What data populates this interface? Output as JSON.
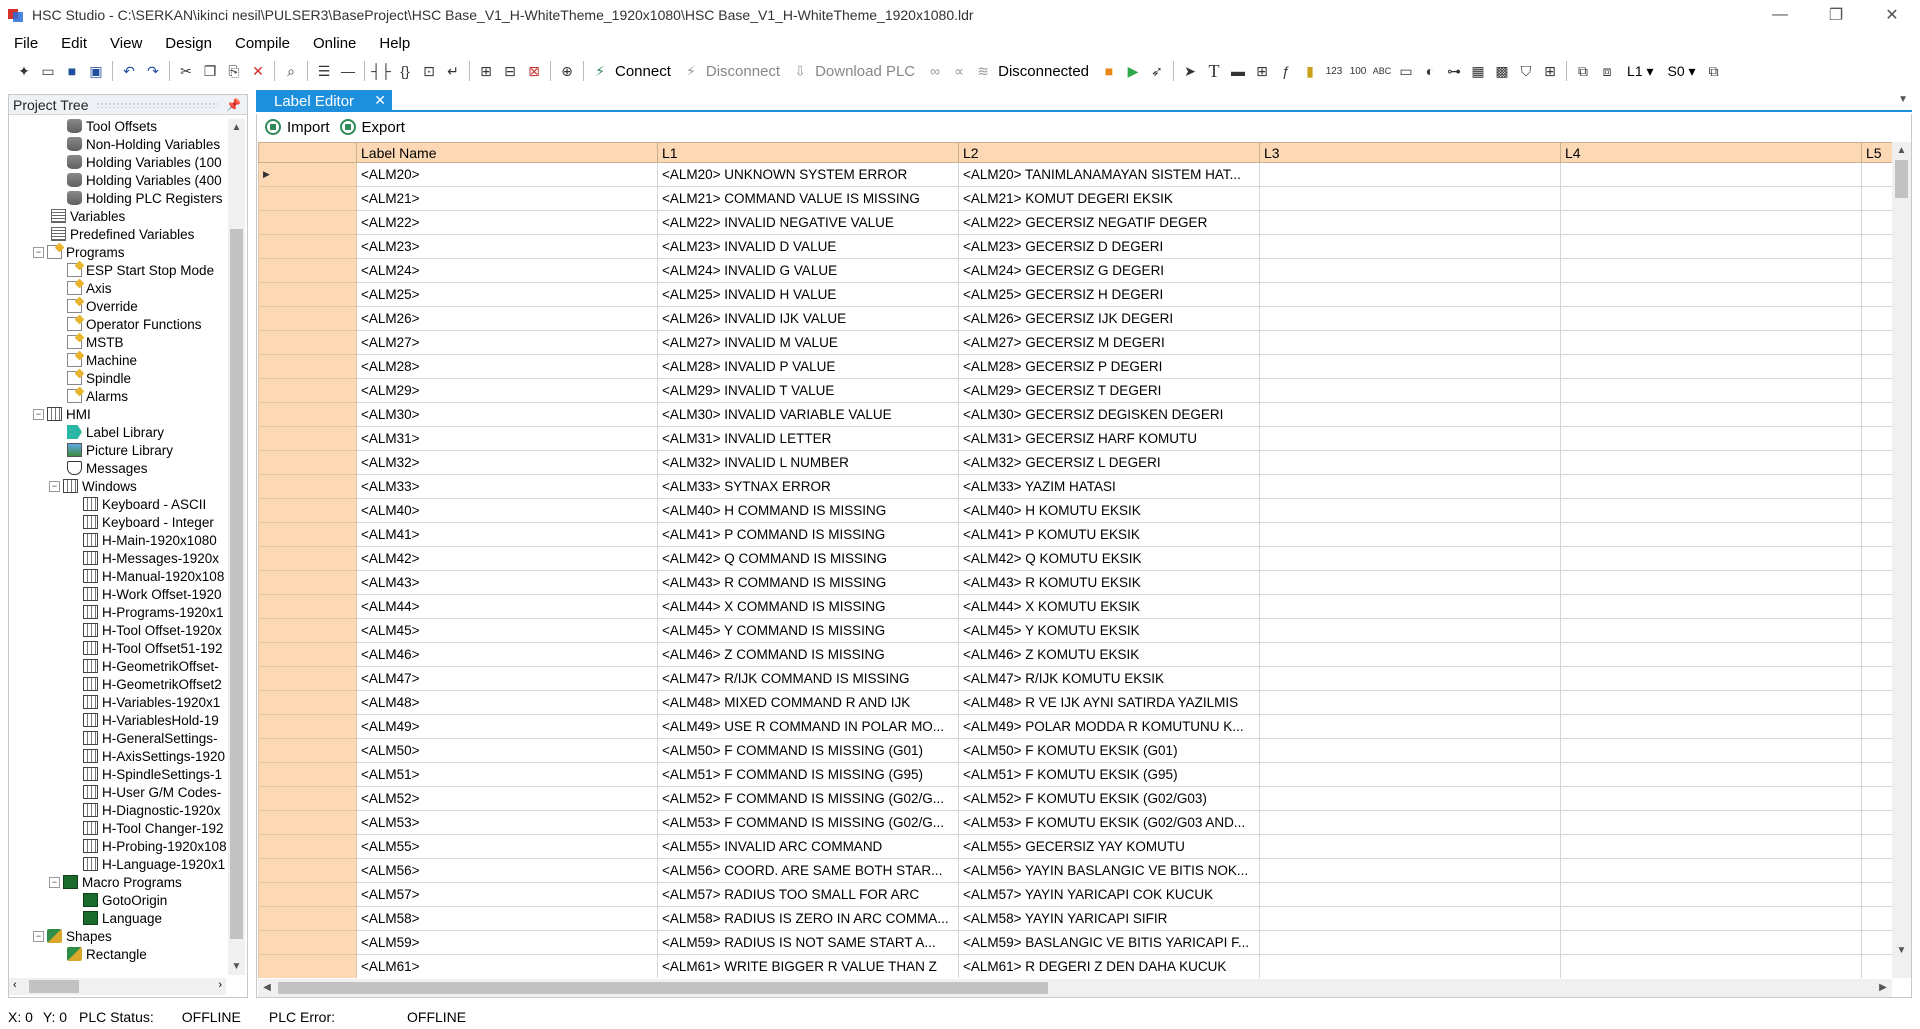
{
  "window": {
    "title": "HSC Studio - C:\\SERKAN\\ikinci nesil\\PULSER3\\BaseProject\\HSC Base_V1_H-WhiteTheme_1920x1080\\HSC Base_V1_H-WhiteTheme_1920x1080.ldr",
    "controls": [
      "—",
      "❐",
      "✕"
    ]
  },
  "menu": [
    "File",
    "Edit",
    "View",
    "Design",
    "Compile",
    "Online",
    "Help"
  ],
  "toolbar": {
    "connect": "Connect",
    "disconnect": "Disconnect",
    "download_plc": "Download PLC",
    "status": "Disconnected",
    "layer": "L1",
    "screen": "S0"
  },
  "sidebar": {
    "title": "Project Tree",
    "items": [
      {
        "label": "Tool Offsets",
        "indent": 3,
        "icon": "database-icon"
      },
      {
        "label": "Non-Holding Variables",
        "indent": 3,
        "icon": "database-icon"
      },
      {
        "label": "Holding Variables (100",
        "indent": 3,
        "icon": "database-icon"
      },
      {
        "label": "Holding Variables (400",
        "indent": 3,
        "icon": "database-icon"
      },
      {
        "label": "Holding PLC Registers",
        "indent": 3,
        "icon": "database-icon"
      },
      {
        "label": "Variables",
        "indent": 2,
        "icon": "list-icon"
      },
      {
        "label": "Predefined Variables",
        "indent": 2,
        "icon": "list-icon"
      },
      {
        "label": "Programs",
        "indent": 2,
        "icon": "program-icon",
        "expander": "−"
      },
      {
        "label": "ESP Start Stop Mode",
        "indent": 3,
        "icon": "program-icon"
      },
      {
        "label": "Axis",
        "indent": 3,
        "icon": "program-icon"
      },
      {
        "label": "Override",
        "indent": 3,
        "icon": "program-icon"
      },
      {
        "label": "Operator Functions",
        "indent": 3,
        "icon": "program-icon"
      },
      {
        "label": "MSTB",
        "indent": 3,
        "icon": "program-icon"
      },
      {
        "label": "Machine",
        "indent": 3,
        "icon": "program-icon"
      },
      {
        "label": "Spindle",
        "indent": 3,
        "icon": "program-icon"
      },
      {
        "label": "Alarms",
        "indent": 3,
        "icon": "program-icon"
      },
      {
        "label": "HMI",
        "indent": 2,
        "icon": "window-icon",
        "expander": "−"
      },
      {
        "label": "Label Library",
        "indent": 3,
        "icon": "tag-icon"
      },
      {
        "label": "Picture Library",
        "indent": 3,
        "icon": "picture-icon"
      },
      {
        "label": "Messages",
        "indent": 3,
        "icon": "shield-icon"
      },
      {
        "label": "Windows",
        "indent": 3,
        "icon": "window-icon",
        "expander": "−"
      },
      {
        "label": "Keyboard - ASCII",
        "indent": 4,
        "icon": "window-icon"
      },
      {
        "label": "Keyboard - Integer",
        "indent": 4,
        "icon": "window-icon"
      },
      {
        "label": "H-Main-1920x1080",
        "indent": 4,
        "icon": "window-icon"
      },
      {
        "label": "H-Messages-1920x",
        "indent": 4,
        "icon": "window-icon"
      },
      {
        "label": "H-Manual-1920x108",
        "indent": 4,
        "icon": "window-icon"
      },
      {
        "label": "H-Work Offset-1920",
        "indent": 4,
        "icon": "window-icon"
      },
      {
        "label": "H-Programs-1920x1",
        "indent": 4,
        "icon": "window-icon"
      },
      {
        "label": "H-Tool Offset-1920x",
        "indent": 4,
        "icon": "window-icon"
      },
      {
        "label": "H-Tool Offset51-192",
        "indent": 4,
        "icon": "window-icon"
      },
      {
        "label": "H-GeometrikOffset-",
        "indent": 4,
        "icon": "window-icon"
      },
      {
        "label": "H-GeometrikOffset2",
        "indent": 4,
        "icon": "window-icon"
      },
      {
        "label": "H-Variables-1920x1",
        "indent": 4,
        "icon": "window-icon"
      },
      {
        "label": "H-VariablesHold-19",
        "indent": 4,
        "icon": "window-icon"
      },
      {
        "label": "H-GeneralSettings-",
        "indent": 4,
        "icon": "window-icon"
      },
      {
        "label": "H-AxisSettings-1920",
        "indent": 4,
        "icon": "window-icon"
      },
      {
        "label": "H-SpindleSettings-1",
        "indent": 4,
        "icon": "window-icon"
      },
      {
        "label": "H-User G/M Codes-",
        "indent": 4,
        "icon": "window-icon"
      },
      {
        "label": "H-Diagnostic-1920x",
        "indent": 4,
        "icon": "window-icon"
      },
      {
        "label": "H-Tool Changer-192",
        "indent": 4,
        "icon": "window-icon"
      },
      {
        "label": "H-Probing-1920x108",
        "indent": 4,
        "icon": "window-icon"
      },
      {
        "label": "H-Language-1920x1",
        "indent": 4,
        "icon": "window-icon"
      },
      {
        "label": "Macro Programs",
        "indent": 3,
        "icon": "macro-icon",
        "expander": "−"
      },
      {
        "label": "GotoOrigin",
        "indent": 4,
        "icon": "macro-icon"
      },
      {
        "label": "Language",
        "indent": 4,
        "icon": "macro-icon"
      },
      {
        "label": "Shapes",
        "indent": 2,
        "icon": "shape-icon",
        "expander": "−"
      },
      {
        "label": "Rectangle",
        "indent": 3,
        "icon": "shape-icon"
      }
    ]
  },
  "tab": {
    "label": "Label Editor",
    "close": "✕"
  },
  "editor": {
    "import_label": "Import",
    "export_label": "Export",
    "columns": [
      "Label Name",
      "L1",
      "L2",
      "L3",
      "L4",
      "L5"
    ],
    "rows": [
      [
        "<ALM20>",
        "<ALM20> UNKNOWN SYSTEM ERROR",
        "<ALM20> TANIMLANAMAYAN SISTEM HAT..."
      ],
      [
        "<ALM21>",
        "<ALM21> COMMAND VALUE IS MISSING",
        "<ALM21> KOMUT DEGERI EKSIK"
      ],
      [
        "<ALM22>",
        "<ALM22> INVALID NEGATIVE VALUE",
        "<ALM22> GECERSIZ NEGATIF DEGER"
      ],
      [
        "<ALM23>",
        "<ALM23> INVALID D VALUE",
        "<ALM23> GECERSIZ D DEGERI"
      ],
      [
        "<ALM24>",
        "<ALM24> INVALID G VALUE",
        "<ALM24> GECERSIZ G DEGERI"
      ],
      [
        "<ALM25>",
        "<ALM25> INVALID H VALUE",
        "<ALM25> GECERSIZ H DEGERI"
      ],
      [
        "<ALM26>",
        "<ALM26> INVALID IJK VALUE",
        "<ALM26> GECERSIZ IJK DEGERI"
      ],
      [
        "<ALM27>",
        "<ALM27> INVALID M VALUE",
        "<ALM27> GECERSIZ M DEGERI"
      ],
      [
        "<ALM28>",
        "<ALM28> INVALID P VALUE",
        "<ALM28> GECERSIZ P DEGERI"
      ],
      [
        "<ALM29>",
        "<ALM29> INVALID T VALUE",
        "<ALM29> GECERSIZ T DEGERI"
      ],
      [
        "<ALM30>",
        "<ALM30> INVALID VARIABLE VALUE",
        "<ALM30> GECERSIZ DEGISKEN DEGERI"
      ],
      [
        "<ALM31>",
        "<ALM31> INVALID LETTER",
        "<ALM31> GECERSIZ HARF KOMUTU"
      ],
      [
        "<ALM32>",
        "<ALM32> INVALID L NUMBER",
        "<ALM32> GECERSIZ L DEGERI"
      ],
      [
        "<ALM33>",
        "<ALM33> SYTNAX ERROR",
        "<ALM33> YAZIM HATASI"
      ],
      [
        "<ALM40>",
        "<ALM40> H COMMAND IS MISSING",
        "<ALM40> H KOMUTU EKSIK"
      ],
      [
        "<ALM41>",
        "<ALM41> P COMMAND IS MISSING",
        "<ALM41> P KOMUTU EKSIK"
      ],
      [
        "<ALM42>",
        "<ALM42> Q COMMAND IS MISSING",
        "<ALM42> Q KOMUTU EKSIK"
      ],
      [
        "<ALM43>",
        "<ALM43> R COMMAND IS MISSING",
        "<ALM43> R KOMUTU EKSIK"
      ],
      [
        "<ALM44>",
        "<ALM44> X COMMAND IS MISSING",
        "<ALM44> X KOMUTU EKSIK"
      ],
      [
        "<ALM45>",
        "<ALM45> Y COMMAND IS MISSING",
        "<ALM45> Y KOMUTU EKSIK"
      ],
      [
        "<ALM46>",
        "<ALM46> Z COMMAND IS MISSING",
        "<ALM46> Z KOMUTU EKSIK"
      ],
      [
        "<ALM47>",
        "<ALM47> R/IJK COMMAND IS MISSING",
        "<ALM47> R/IJK KOMUTU EKSIK"
      ],
      [
        "<ALM48>",
        "<ALM48> MIXED COMMAND R AND IJK",
        "<ALM48> R VE IJK AYNI SATIRDA YAZILMIS"
      ],
      [
        "<ALM49>",
        "<ALM49> USE R COMMAND IN POLAR MO...",
        "<ALM49> POLAR MODDA R KOMUTUNU K..."
      ],
      [
        "<ALM50>",
        "<ALM50> F COMMAND IS MISSING (G01)",
        "<ALM50> F KOMUTU EKSIK (G01)"
      ],
      [
        "<ALM51>",
        "<ALM51> F COMMAND IS MISSING (G95)",
        "<ALM51> F KOMUTU EKSIK (G95)"
      ],
      [
        "<ALM52>",
        "<ALM52> F COMMAND IS MISSING (G02/G...",
        "<ALM52> F KOMUTU EKSIK (G02/G03)"
      ],
      [
        "<ALM53>",
        "<ALM53> F COMMAND IS MISSING (G02/G...",
        "<ALM53> F KOMUTU EKSIK (G02/G03 AND..."
      ],
      [
        "<ALM55>",
        "<ALM55> INVALID ARC COMMAND",
        "<ALM55> GECERSIZ YAY KOMUTU"
      ],
      [
        "<ALM56>",
        "<ALM56> COORD. ARE SAME BOTH STAR...",
        "<ALM56> YAYIN BASLANGIC VE BITIS NOK..."
      ],
      [
        "<ALM57>",
        "<ALM57> RADIUS TOO SMALL FOR ARC",
        "<ALM57> YAYIN YARICAPI COK KUCUK"
      ],
      [
        "<ALM58>",
        "<ALM58> RADIUS IS ZERO IN ARC COMMA...",
        "<ALM58> YAYIN YARICAPI SIFIR"
      ],
      [
        "<ALM59>",
        "<ALM59> RADIUS IS NOT SAME START A...",
        "<ALM59> BASLANGIC VE BITIS YARICAPI F..."
      ],
      [
        "<ALM61>",
        "<ALM61> WRITE BIGGER R VALUE THAN Z",
        "<ALM61> R DEGERI Z DEN DAHA KUCUK"
      ]
    ]
  },
  "status": {
    "x": "X:  0",
    "y": "Y:  0",
    "plc_status_label": "PLC Status:",
    "plc_status_value": "OFFLINE",
    "plc_error_label": "PLC Error:",
    "plc_error_value": "OFFLINE"
  }
}
